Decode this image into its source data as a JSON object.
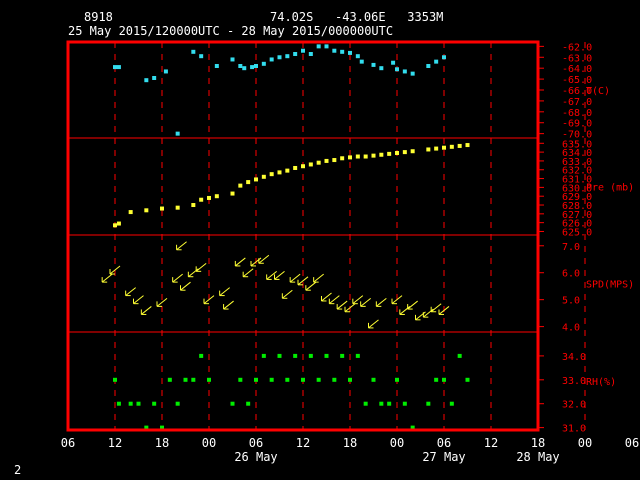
{
  "header": {
    "station_id": "8918",
    "location": "74.02S   -43.06E   3353M",
    "time_range": "25 May 2015/120000UTC - 28 May 2015/000000UTC"
  },
  "page_number": "2",
  "colors": {
    "background": "#000000",
    "frame": "#ff0000",
    "grid": "#ff0000",
    "axis_text": "#ffffff",
    "right_label": "#ff0000",
    "temperature": "#33ddee",
    "pressure": "#ffff33",
    "wind": "#ffff33",
    "humidity": "#00ee00"
  },
  "x_axis": {
    "range_hours": [
      -6,
      54
    ],
    "tick_labels": [
      "06",
      "12",
      "18",
      "00",
      "06",
      "12",
      "18",
      "00",
      "06",
      "12",
      "18",
      "00",
      "06"
    ],
    "day_labels": [
      {
        "label": "26 May",
        "hour": 18
      },
      {
        "label": "27 May",
        "hour": 42
      },
      {
        "label": "28 May",
        "hour": 54
      }
    ]
  },
  "chart_data": [
    {
      "type": "scatter",
      "name": "temperature",
      "ylabel": "T(C)",
      "ylim": [
        -70.4,
        -61.6
      ],
      "tick_labels": [
        "-62.0",
        "-63.0",
        "-64.0",
        "-65.0",
        "-66.0",
        "-67.0",
        "-68.0",
        "-69.0",
        "-70.0"
      ],
      "x": [
        0,
        0.5,
        4,
        5,
        6.5,
        8,
        10,
        11,
        13,
        15,
        16,
        16.5,
        17.5,
        18,
        19,
        20,
        21,
        22,
        23,
        24,
        25,
        26,
        27,
        28,
        29,
        30,
        31,
        31.5,
        33,
        34,
        35.5,
        36,
        37,
        38,
        40,
        41,
        42
      ],
      "y": [
        -63.9,
        -63.9,
        -65.1,
        -64.9,
        -64.3,
        -70.0,
        -62.5,
        -62.9,
        -63.8,
        -63.2,
        -63.8,
        -64.0,
        -63.9,
        -63.8,
        -63.6,
        -63.2,
        -63.0,
        -62.9,
        -62.7,
        -62.4,
        -62.7,
        -62.0,
        -62.0,
        -62.4,
        -62.5,
        -62.6,
        -62.9,
        -63.4,
        -63.7,
        -64.0,
        -63.5,
        -64.1,
        -64.3,
        -64.5,
        -63.8,
        -63.4,
        -63.0
      ]
    },
    {
      "type": "scatter",
      "name": "pressure",
      "ylabel": "Pre (mb)",
      "ylim": [
        624.6,
        635.6
      ],
      "tick_labels": [
        "625.0",
        "626.0",
        "627.0",
        "628.0",
        "629.0",
        "630.0",
        "631.0",
        "632.0",
        "633.0",
        "634.0",
        "635.0"
      ],
      "x": [
        0,
        0.5,
        2,
        4,
        6,
        8,
        10,
        11,
        12,
        13,
        15,
        16,
        17,
        18,
        19,
        20,
        21,
        22,
        23,
        24,
        25,
        26,
        27,
        28,
        29,
        30,
        31,
        32,
        33,
        34,
        35,
        36,
        37,
        38,
        40,
        41,
        42,
        43,
        44,
        45
      ],
      "y": [
        625.7,
        625.9,
        627.2,
        627.4,
        627.6,
        627.7,
        628.0,
        628.6,
        628.8,
        629.0,
        629.3,
        630.2,
        630.6,
        630.9,
        631.2,
        631.5,
        631.7,
        631.9,
        632.2,
        632.4,
        632.6,
        632.8,
        633.0,
        633.1,
        633.3,
        633.4,
        633.5,
        633.5,
        633.6,
        633.7,
        633.8,
        633.9,
        634.0,
        634.1,
        634.3,
        634.4,
        634.5,
        634.6,
        634.7,
        634.8
      ]
    },
    {
      "type": "scatter",
      "name": "wind",
      "ylabel": "SPD(MPS)",
      "ylim": [
        3.8,
        7.4
      ],
      "tick_labels": [
        "4.0",
        "5.0",
        "6.0",
        "7.0"
      ],
      "x": [
        -1,
        0,
        2,
        3,
        4,
        6,
        8,
        8.5,
        9,
        10,
        11,
        12,
        14,
        14.5,
        16,
        17,
        18,
        19,
        20,
        21,
        22,
        23,
        24,
        25,
        26,
        27,
        28,
        29,
        30,
        31,
        32,
        33,
        34,
        36,
        37,
        38,
        39,
        40,
        41,
        42
      ],
      "y": [
        5.8,
        6.1,
        5.3,
        5.0,
        4.6,
        4.9,
        5.8,
        7.0,
        5.5,
        6.0,
        6.2,
        5.0,
        5.3,
        4.8,
        6.4,
        6.0,
        6.4,
        6.5,
        5.9,
        5.9,
        5.2,
        5.8,
        5.7,
        5.5,
        5.8,
        5.1,
        5.0,
        4.8,
        4.7,
        5.0,
        4.9,
        4.1,
        4.9,
        5.0,
        4.6,
        4.8,
        4.4,
        4.5,
        4.7,
        4.6
      ]
    },
    {
      "type": "scatter",
      "name": "humidity",
      "ylabel": "RH(%)",
      "ylim": [
        30.9,
        35.0
      ],
      "tick_labels": [
        "31.0",
        "32.0",
        "33.0",
        "34.0"
      ],
      "x": [
        0,
        0.5,
        2,
        3,
        4,
        5,
        6,
        7,
        8,
        9,
        10,
        11,
        12,
        15,
        16,
        17,
        18,
        19,
        20,
        21,
        22,
        23,
        24,
        25,
        26,
        27,
        28,
        29,
        30,
        31,
        32,
        33,
        34,
        35,
        36,
        37,
        38,
        40,
        41,
        42,
        43,
        44,
        45
      ],
      "y": [
        33.0,
        32.0,
        32.0,
        32.0,
        31.0,
        32.0,
        31.0,
        33.0,
        32.0,
        33.0,
        33.0,
        34.0,
        33.0,
        32.0,
        33.0,
        32.0,
        33.0,
        34.0,
        33.0,
        34.0,
        33.0,
        34.0,
        33.0,
        34.0,
        33.0,
        34.0,
        33.0,
        34.0,
        33.0,
        34.0,
        32.0,
        33.0,
        32.0,
        32.0,
        33.0,
        32.0,
        31.0,
        32.0,
        33.0,
        33.0,
        32.0,
        34.0,
        33.0
      ]
    }
  ]
}
